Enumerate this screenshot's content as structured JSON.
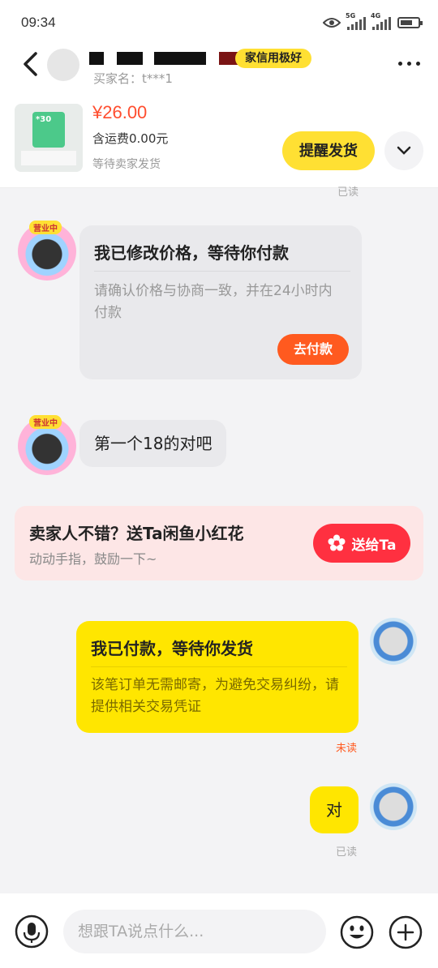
{
  "status_bar": {
    "time": "09:34",
    "net1": "5G",
    "net2": "4G"
  },
  "header": {
    "credit_badge": "家信用极好",
    "subname": "买家名：t***1",
    "product": {
      "price": "¥26.00",
      "shipping": "含运费0.00元",
      "status": "等待卖家发货",
      "card_value": "*30"
    },
    "remind_button": "提醒发货"
  },
  "messages": {
    "read_top": "已读",
    "price_card": {
      "title": "我已修改价格，等待你付款",
      "body": "请确认价格与协商一致，并在24小时内付款",
      "button": "去付款"
    },
    "seller_tag": "营业中",
    "text_msg": "第一个18的对吧",
    "flower": {
      "title": "卖家人不错？送Ta闲鱼小红花",
      "subtitle": "动动手指，鼓励一下~",
      "button": "送给Ta"
    },
    "paid_card": {
      "title": "我已付款，等待你发货",
      "body": "该笔订单无需邮寄，为避免交易纠纷，请提供相关交易凭证",
      "status": "未读"
    },
    "reply": {
      "text": "对",
      "status": "已读"
    }
  },
  "input": {
    "placeholder": "想跟TA说点什么..."
  },
  "colors": {
    "brand_yellow": "#ffe600",
    "accent_orange": "#ff5a1f",
    "price_red": "#ff4d2e",
    "unread_red": "#ff5a1f"
  }
}
